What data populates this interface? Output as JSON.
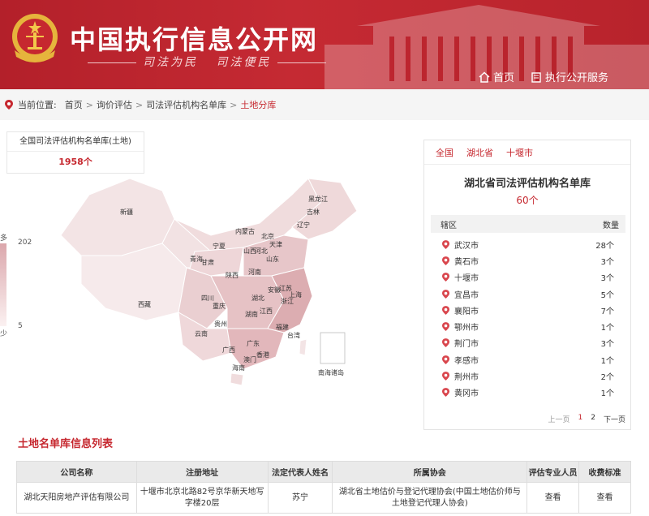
{
  "header": {
    "title": "中国执行信息公开网",
    "slogan_left": "司法为民",
    "slogan_right": "司法便民",
    "nav": [
      {
        "label": "首页",
        "icon": "home-icon"
      },
      {
        "label": "执行公开服务",
        "icon": "service-icon"
      }
    ]
  },
  "breadcrumb": {
    "prefix": "当前位置:",
    "items": [
      "首页",
      "询价评估",
      "司法评估机构名单库"
    ],
    "current": "土地分库"
  },
  "total": {
    "title": "全国司法评估机构名单库(土地)",
    "value": "1958个"
  },
  "map": {
    "legend_max": "202",
    "legend_min": "5",
    "legend_top_label": "多",
    "legend_bottom_label": "少",
    "labels": [
      "黑龙江",
      "吉林",
      "辽宁",
      "北京",
      "天津",
      "内蒙古",
      "新疆",
      "宁夏",
      "甘肃",
      "青海",
      "山西",
      "河北",
      "山东",
      "陕西",
      "河南",
      "江苏",
      "安徽",
      "上海",
      "湖北",
      "四川",
      "重庆",
      "浙江",
      "西藏",
      "湖南",
      "江西",
      "贵州",
      "福建",
      "台湾",
      "云南",
      "广西",
      "广东",
      "香港",
      "澳门",
      "海南",
      "南海诸岛"
    ]
  },
  "province": {
    "tabs": [
      "全国",
      "湖北省",
      "十堰市"
    ],
    "title": "湖北省司法评估机构名单库",
    "count": "60个",
    "col_area": "辖区",
    "col_count": "数量",
    "rows": [
      {
        "name": "武汉市",
        "count": "28个"
      },
      {
        "name": "黄石市",
        "count": "3个"
      },
      {
        "name": "十堰市",
        "count": "3个"
      },
      {
        "name": "宜昌市",
        "count": "5个"
      },
      {
        "name": "襄阳市",
        "count": "7个"
      },
      {
        "name": "鄂州市",
        "count": "1个"
      },
      {
        "name": "荆门市",
        "count": "3个"
      },
      {
        "name": "孝感市",
        "count": "1个"
      },
      {
        "name": "荆州市",
        "count": "2个"
      },
      {
        "name": "黄冈市",
        "count": "1个"
      }
    ],
    "pager": {
      "prev": "上一页",
      "p1": "1",
      "p2": "2",
      "next": "下一页"
    }
  },
  "section": {
    "title": "土地名单库信息列表",
    "headers": [
      "公司名称",
      "注册地址",
      "法定代表人姓名",
      "所属协会",
      "评估专业人员",
      "收费标准"
    ],
    "rows": [
      {
        "company": "湖北天阳房地产评估有限公司",
        "address": "十堰市北京北路82号京华新天地写字楼20层",
        "legal_rep": "苏宁",
        "association": "湖北省土地估价与登记代理协会(中国土地估价师与土地登记代理人协会)",
        "staff": "查看",
        "fee": "查看"
      }
    ]
  },
  "colors": {
    "brand_red": "#c6282f",
    "header_red": "#b3202a"
  }
}
